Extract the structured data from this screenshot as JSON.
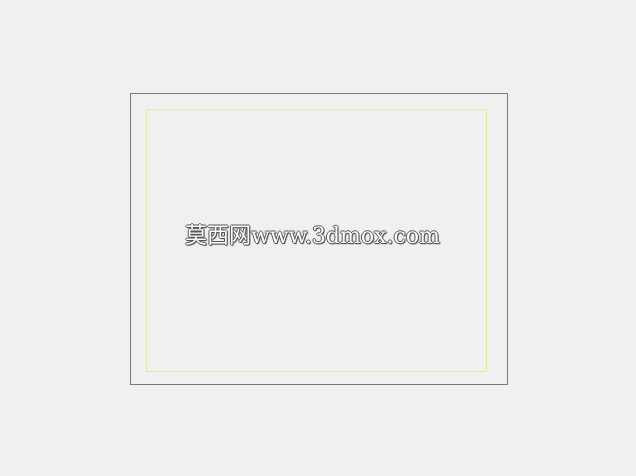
{
  "watermark": {
    "text": "莫西网www.3dmox.com"
  },
  "colors": {
    "background": "#f0f0f0",
    "outer_border": "#7a7a7a",
    "inner_border": "#e6eb9a"
  }
}
